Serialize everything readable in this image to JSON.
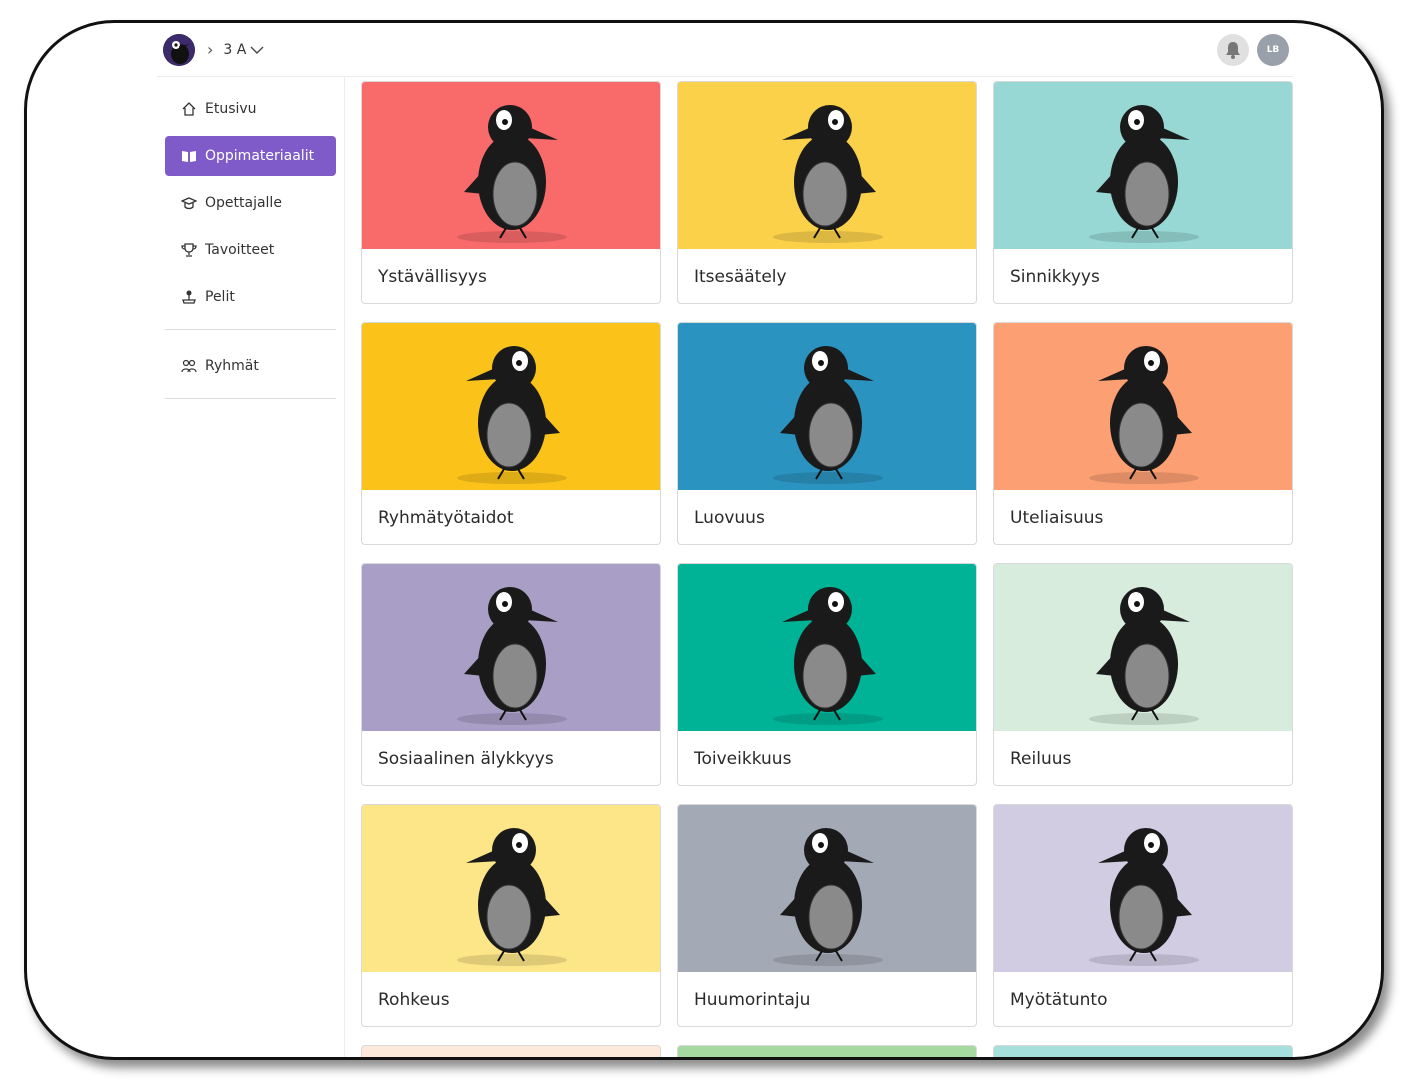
{
  "header": {
    "breadcrumb_sep": "›",
    "group_label": "3 A",
    "avatar_initials": "LB"
  },
  "sidebar": {
    "items": [
      {
        "label": "Etusivu",
        "icon": "home-icon"
      },
      {
        "label": "Oppimateriaalit",
        "icon": "book-icon",
        "active": true
      },
      {
        "label": "Opettajalle",
        "icon": "graduation-cap-icon"
      },
      {
        "label": "Tavoitteet",
        "icon": "trophy-icon"
      },
      {
        "label": "Pelit",
        "icon": "joystick-icon"
      }
    ],
    "groups_label": "Ryhmät"
  },
  "cards": [
    {
      "title": "Ystävällisyys",
      "color": "#f96a6b"
    },
    {
      "title": "Itsesäätely",
      "color": "#fbd14a"
    },
    {
      "title": "Sinnikkyys",
      "color": "#97d8d4"
    },
    {
      "title": "Ryhmätyötaidot",
      "color": "#fbc31a"
    },
    {
      "title": "Luovuus",
      "color": "#2b93bf"
    },
    {
      "title": "Uteliaisuus",
      "color": "#fc9f72"
    },
    {
      "title": "Sosiaalinen älykkyys",
      "color": "#a99ec6"
    },
    {
      "title": "Toiveikkuus",
      "color": "#00b397"
    },
    {
      "title": "Reiluus",
      "color": "#d7ecdc"
    },
    {
      "title": "Rohkeus",
      "color": "#fde687"
    },
    {
      "title": "Huumorintaju",
      "color": "#a3a9b5"
    },
    {
      "title": "Myötätunto",
      "color": "#d2cce2"
    }
  ],
  "stub_colors": [
    "#fde8dc",
    "#a6d9a0",
    "#a6e0dc"
  ],
  "colors": {
    "accent": "#7f5bc9",
    "crow": "#1a1a1a",
    "crow_belly": "#8a8a8a",
    "beak": "#f5a623"
  }
}
